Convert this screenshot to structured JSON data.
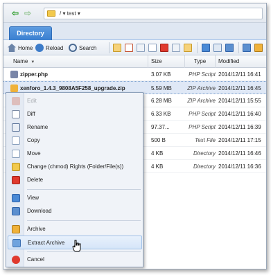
{
  "address": {
    "path_root": "/",
    "path_folder": "test"
  },
  "tabs": [
    {
      "label": "Directory"
    }
  ],
  "toolbar": {
    "home_label": "Home",
    "reload_label": "Reload",
    "search_label": "Search"
  },
  "grid": {
    "columns": {
      "name": "Name",
      "size": "Size",
      "type": "Type",
      "modified": "Modified"
    },
    "rows": [
      {
        "name": "zipper.php",
        "size": "3.07 KB",
        "type": "PHP Script",
        "modified": "2014/12/11 16:41"
      },
      {
        "name": "xenforo_1.4.3_9808A5F258_upgrade.zip",
        "size": "5.59 MB",
        "type": "ZIP Archive",
        "modified": "2014/12/11 16:45"
      },
      {
        "name": "",
        "size": "6.28 MB",
        "type": "ZIP Archive",
        "modified": "2014/12/11 15:55"
      },
      {
        "name": "",
        "size": "6.33 KB",
        "type": "PHP Script",
        "modified": "2014/12/11 16:40"
      },
      {
        "name": "",
        "size": "97.37...",
        "type": "PHP Script",
        "modified": "2014/12/11 16:39"
      },
      {
        "name": "",
        "size": "500 B",
        "type": "Text File",
        "modified": "2014/12/11 17:15"
      },
      {
        "name": "",
        "size": "4 KB",
        "type": "Directory",
        "modified": "2014/12/11 16:46"
      },
      {
        "name": "",
        "size": "4 KB",
        "type": "Directory",
        "modified": "2014/12/11 16:36"
      }
    ]
  },
  "context_menu": {
    "edit": "Edit",
    "diff": "Diff",
    "rename": "Rename",
    "copy": "Copy",
    "move": "Move",
    "chmod": "Change (chmod) Rights (Folder/File(s))",
    "delete": "Delete",
    "view": "View",
    "download": "Download",
    "archive": "Archive",
    "extract": "Extract Archive",
    "cancel": "Cancel"
  },
  "colors": {
    "accent": "#3a7fd0",
    "selection": "#dfe8f6",
    "menu_bg": "#f0f3f8"
  }
}
